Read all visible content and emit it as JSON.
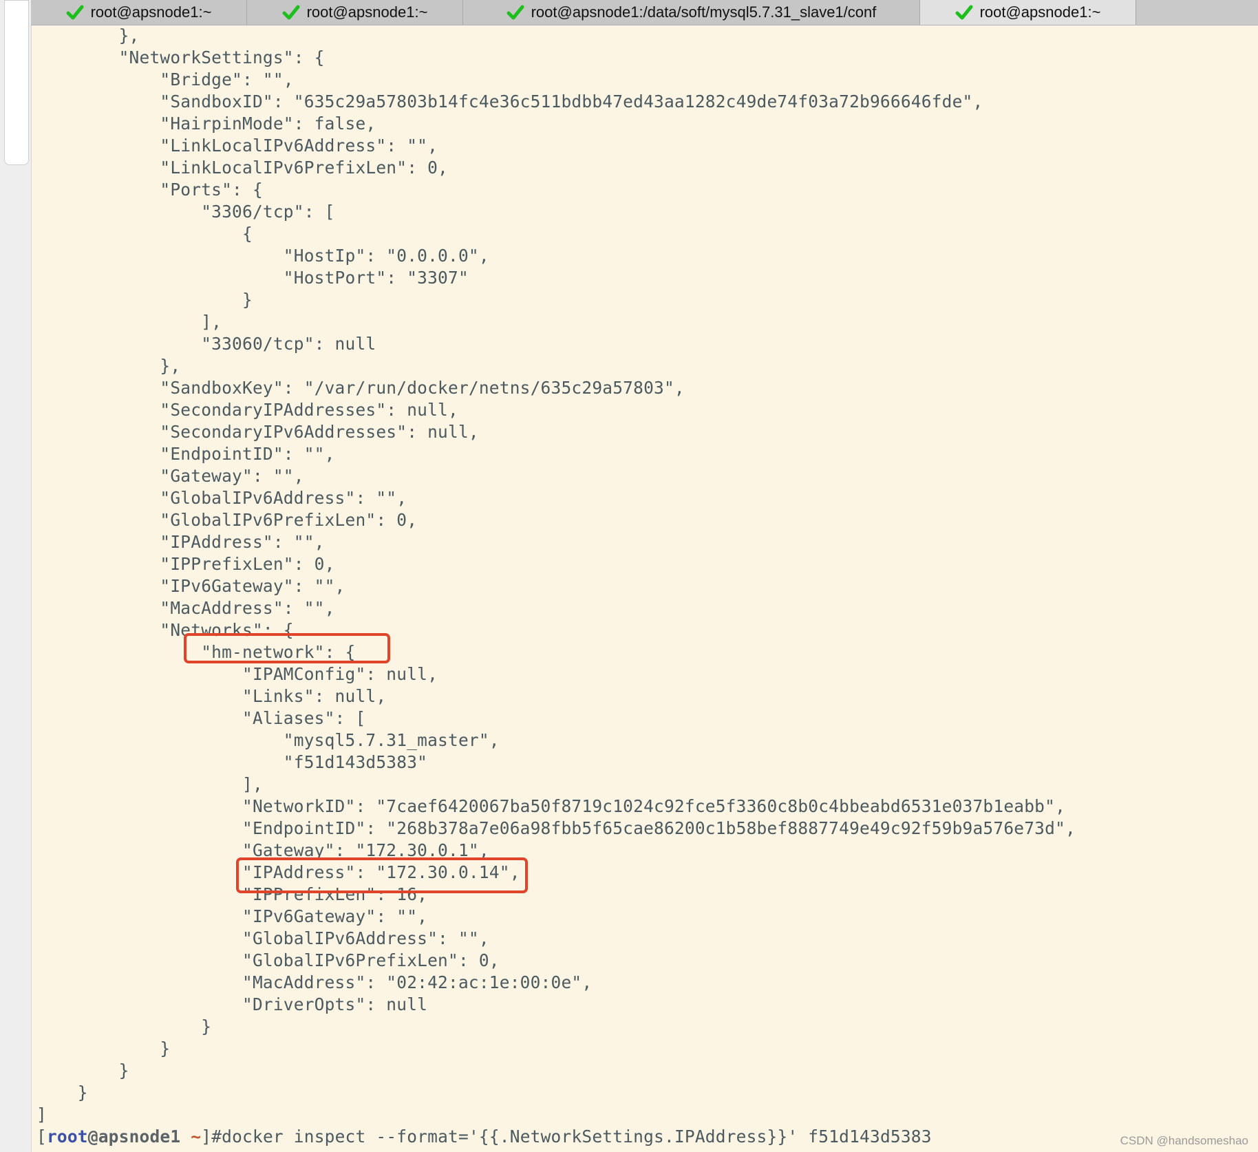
{
  "tabs": [
    {
      "title": "root@apsnode1:~",
      "status_icon": "green-check-icon"
    },
    {
      "title": "root@apsnode1:~",
      "status_icon": "green-check-icon"
    },
    {
      "title": "root@apsnode1:/data/soft/mysql5.7.31_slave1/conf",
      "status_icon": "green-check-icon"
    },
    {
      "title": "root@apsnode1:~",
      "status_icon": "green-check-icon"
    }
  ],
  "active_tab_index": 3,
  "colors": {
    "terminal_background": "#fcf5e3",
    "terminal_text": "#4b5a60",
    "highlight_box": "#e0452b",
    "check_icon": "#1dbf1d"
  },
  "terminal": {
    "lines": [
      "        },",
      "        \"NetworkSettings\": {",
      "            \"Bridge\": \"\",",
      "            \"SandboxID\": \"635c29a57803b14fc4e36c511bdbb47ed43aa1282c49de74f03a72b966646fde\",",
      "            \"HairpinMode\": false,",
      "            \"LinkLocalIPv6Address\": \"\",",
      "            \"LinkLocalIPv6PrefixLen\": 0,",
      "            \"Ports\": {",
      "                \"3306/tcp\": [",
      "                    {",
      "                        \"HostIp\": \"0.0.0.0\",",
      "                        \"HostPort\": \"3307\"",
      "                    }",
      "                ],",
      "                \"33060/tcp\": null",
      "            },",
      "            \"SandboxKey\": \"/var/run/docker/netns/635c29a57803\",",
      "            \"SecondaryIPAddresses\": null,",
      "            \"SecondaryIPv6Addresses\": null,",
      "            \"EndpointID\": \"\",",
      "            \"Gateway\": \"\",",
      "            \"GlobalIPv6Address\": \"\",",
      "            \"GlobalIPv6PrefixLen\": 0,",
      "            \"IPAddress\": \"\",",
      "            \"IPPrefixLen\": 0,",
      "            \"IPv6Gateway\": \"\",",
      "            \"MacAddress\": \"\",",
      "            \"Networks\": {",
      "                \"hm-network\": {",
      "                    \"IPAMConfig\": null,",
      "                    \"Links\": null,",
      "                    \"Aliases\": [",
      "                        \"mysql5.7.31_master\",",
      "                        \"f51d143d5383\"",
      "                    ],",
      "                    \"NetworkID\": \"7caef6420067ba50f8719c1024c92fce5f3360c8b0c4bbeabd6531e037b1eabb\",",
      "                    \"EndpointID\": \"268b378a7e06a98fbb5f65cae86200c1b58bef8887749e49c92f59b9a576e73d\",",
      "                    \"Gateway\": \"172.30.0.1\",",
      "                    \"IPAddress\": \"172.30.0.14\",",
      "                    \"IPPrefixLen\": 16,",
      "                    \"IPv6Gateway\": \"\",",
      "                    \"GlobalIPv6Address\": \"\",",
      "                    \"GlobalIPv6PrefixLen\": 0,",
      "                    \"MacAddress\": \"02:42:ac:1e:00:0e\",",
      "                    \"DriverOpts\": null",
      "                }",
      "            }",
      "        }",
      "    }",
      "]"
    ],
    "prompt": {
      "open_bracket": "[",
      "user": "root",
      "at_host": "@apsnode1",
      "tilde": " ~",
      "close_bracket": "]",
      "symbol": "#",
      "command": "docker inspect --format='{{.NetworkSettings.IPAddress}}' f51d143d5383"
    }
  },
  "watermark": "CSDN @handsomeshao"
}
